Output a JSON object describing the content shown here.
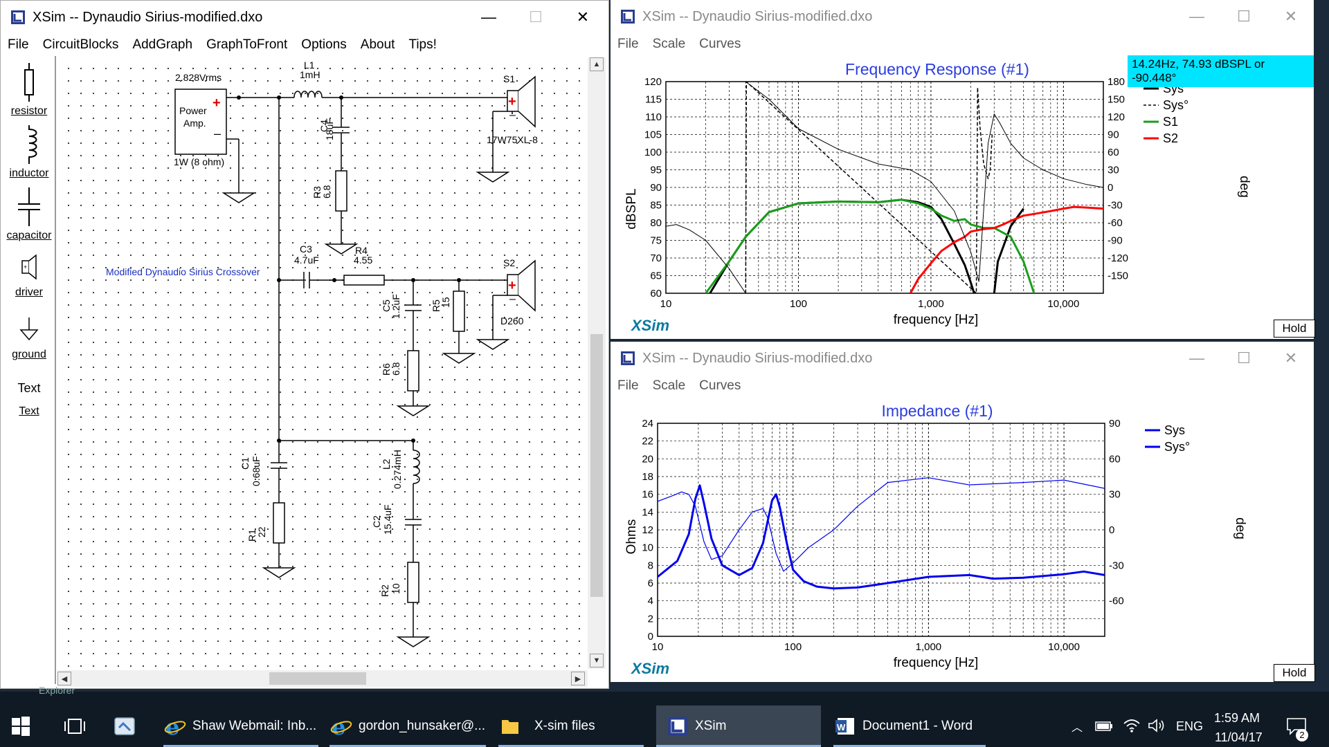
{
  "schematic": {
    "window_title": "XSim -- Dynaudio Sirius-modified.dxo",
    "menu": [
      "File",
      "CircuitBlocks",
      "AddGraph",
      "GraphToFront",
      "Options",
      "About",
      "Tips!"
    ],
    "palette": [
      {
        "icon": "resistor-icon",
        "label": "resistor"
      },
      {
        "icon": "inductor-icon",
        "label": "inductor"
      },
      {
        "icon": "capacitor-icon",
        "label": "capacitor"
      },
      {
        "icon": "driver-icon",
        "label": "driver"
      },
      {
        "icon": "ground-icon",
        "label": "ground"
      },
      {
        "icon": "text-icon",
        "glyph": "Text",
        "label": "Text"
      }
    ],
    "labels": {
      "source_voltage": "2.828Vrms",
      "source_name": "Power\nAmp.",
      "source_power": "1W (8 ohm)",
      "note": "Modified Dynaudio Sirius Crossover",
      "L1": "L1",
      "L1_val": "1mH",
      "C4": "C4",
      "C4_val": "18uF",
      "R3": "R3",
      "R3_val": "6.8",
      "S1": "S1",
      "S1_model": "17W75XL-8",
      "C3": "C3",
      "C3_val": "4.7uF",
      "R4": "R4",
      "R4_val": "4.55",
      "S2": "S2",
      "S2_model": "D260",
      "C5": "C5",
      "C5_val": "1.2uF",
      "R5": "R5",
      "R5_val": "15",
      "R6": "R6",
      "R6_val": "6.8",
      "C1": "C1",
      "C1_val": "0.68uF",
      "R1": "R1",
      "R1_val": "22",
      "L2": "L2",
      "L2_val": "0.274mH",
      "C2": "C2",
      "C2_val": "15.4uF",
      "R2": "R2",
      "R2_val": "10"
    }
  },
  "freq_window": {
    "window_title": "XSim -- Dynaudio Sirius-modified.dxo",
    "menu": [
      "File",
      "Scale",
      "Curves"
    ],
    "title": "Frequency Response (#1)",
    "readout": "14.24Hz, 74.93 dBSPL or -90.448°",
    "xlabel": "frequency [Hz]",
    "ylabel": "dBSPL",
    "y2label": "deg",
    "brand": "XSim",
    "hold_label": "Hold"
  },
  "imp_window": {
    "window_title": "XSim -- Dynaudio Sirius-modified.dxo",
    "menu": [
      "File",
      "Scale",
      "Curves"
    ],
    "title": "Impedance (#1)",
    "xlabel": "frequency [Hz]",
    "ylabel": "Ohms",
    "y2label": "deg",
    "brand": "XSim",
    "hold_label": "Hold"
  },
  "chart_data": [
    {
      "type": "line",
      "title": "Frequency Response (#1)",
      "xlabel": "frequency [Hz]",
      "ylabel": "dBSPL",
      "y2label": "deg",
      "xscale": "log",
      "xlim": [
        10,
        20000
      ],
      "ylim": [
        60,
        120
      ],
      "y2lim": [
        -180,
        180
      ],
      "x_ticks": [
        "10",
        "100",
        "1,000",
        "10,000"
      ],
      "y_ticks": [
        "60",
        "65",
        "70",
        "75",
        "80",
        "85",
        "90",
        "95",
        "100",
        "105",
        "110",
        "115",
        "120"
      ],
      "y2_ticks": [
        "-150",
        "-120",
        "-90",
        "-60",
        "-30",
        "0",
        "30",
        "60",
        "90",
        "120",
        "150",
        "180"
      ],
      "grid": true,
      "legend_position": "right",
      "series": [
        {
          "name": "Sys",
          "axis": "left",
          "color": "#000000",
          "style": "solid",
          "width": 3,
          "x": [
            10,
            15,
            20,
            30,
            40,
            60,
            100,
            200,
            400,
            600,
            800,
            1000,
            1200,
            1500,
            1800,
            2000,
            2200,
            2400,
            2600,
            3000,
            3200,
            4000,
            5000
          ],
          "y": [
            52,
            55,
            58,
            69,
            76,
            83,
            85.5,
            86,
            85.8,
            86.5,
            85.8,
            84.5,
            81,
            74,
            68,
            63,
            58,
            55,
            56,
            60,
            69,
            79,
            84
          ]
        },
        {
          "name": "Sys°",
          "axis": "right",
          "color": "#000000",
          "style": "dashed",
          "width": 1.5,
          "x": [
            40,
            40.5,
            2200,
            2250,
            2350,
            2500,
            2700,
            2800,
            2900
          ],
          "y": [
            -180,
            180,
            -180,
            170,
            100,
            40,
            15,
            30,
            90
          ]
        },
        {
          "name": "S1",
          "axis": "left",
          "color": "#1a9e1a",
          "style": "solid",
          "width": 3,
          "x": [
            20,
            30,
            40,
            60,
            100,
            200,
            400,
            600,
            800,
            1000,
            1200,
            1500,
            1800,
            2000,
            2500,
            3000,
            4000,
            5000,
            6000
          ],
          "y": [
            60,
            69,
            76,
            83,
            85.5,
            86,
            85.8,
            86.5,
            85.5,
            84,
            82,
            80.5,
            81,
            79.5,
            78.5,
            78.5,
            76,
            69,
            60
          ]
        },
        {
          "name": "S2",
          "axis": "left",
          "color": "#ff0000",
          "style": "solid",
          "width": 3,
          "x": [
            700,
            800,
            1000,
            1200,
            1500,
            1800,
            2000,
            2500,
            3000,
            3500,
            4000,
            5000,
            6000,
            8000,
            10000,
            12000,
            15000,
            20000
          ],
          "y": [
            60,
            64,
            68.5,
            72,
            74.5,
            76,
            77.5,
            78.2,
            78.5,
            79.5,
            80.5,
            82,
            82.5,
            83.3,
            84,
            84.5,
            84.3,
            84
          ]
        },
        {
          "name": "",
          "axis": "left",
          "color": "#000000",
          "style": "solid",
          "width": 1,
          "x": [
            10,
            12,
            15,
            20,
            30,
            40
          ],
          "y": [
            79,
            79.5,
            78,
            75,
            67,
            60
          ]
        },
        {
          "name": "",
          "axis": "right",
          "color": "#000000",
          "style": "solid",
          "width": 1,
          "x": [
            40,
            60,
            100,
            200,
            400,
            700,
            1000,
            1500,
            2000,
            2300,
            2700,
            3000,
            3300,
            4000,
            5000,
            7000,
            10000,
            15000,
            20000
          ],
          "y": [
            180,
            150,
            100,
            65,
            40,
            30,
            10,
            -40,
            -110,
            -160,
            75,
            125,
            110,
            75,
            50,
            30,
            15,
            5,
            0
          ]
        }
      ]
    },
    {
      "type": "line",
      "title": "Impedance (#1)",
      "xlabel": "frequency [Hz]",
      "ylabel": "Ohms",
      "y2label": "deg",
      "xscale": "log",
      "xlim": [
        10,
        20000
      ],
      "ylim": [
        0,
        24
      ],
      "y2lim": [
        -90,
        90
      ],
      "x_ticks": [
        "10",
        "100",
        "1,000",
        "10,000"
      ],
      "y_ticks": [
        "0",
        "2",
        "4",
        "6",
        "8",
        "10",
        "12",
        "14",
        "16",
        "18",
        "20",
        "22",
        "24"
      ],
      "y2_ticks": [
        "-60",
        "-30",
        "0",
        "30",
        "60",
        "90"
      ],
      "grid": true,
      "legend_position": "top-right",
      "series": [
        {
          "name": "Sys",
          "axis": "left",
          "color": "#0000ee",
          "style": "solid",
          "width": 3,
          "x": [
            10,
            14,
            17,
            19,
            20.5,
            22,
            25,
            30,
            40,
            50,
            60,
            70,
            75,
            80,
            90,
            100,
            120,
            150,
            200,
            300,
            500,
            1000,
            2000,
            3000,
            5000,
            10000,
            14000,
            20000
          ],
          "y": [
            6.7,
            8.5,
            11.5,
            15.5,
            17.0,
            15,
            11,
            8,
            6.9,
            7.7,
            10.5,
            15.3,
            16.0,
            14.5,
            10.5,
            7.5,
            6.2,
            5.6,
            5.4,
            5.5,
            6.0,
            6.7,
            6.9,
            6.5,
            6.6,
            7.0,
            7.3,
            6.9
          ]
        },
        {
          "name": "Sys°",
          "axis": "right",
          "color": "#0000ee",
          "style": "solid",
          "width": 1.2,
          "x": [
            10,
            13,
            15,
            17,
            19,
            22,
            25,
            30,
            40,
            50,
            60,
            65,
            75,
            85,
            100,
            130,
            200,
            300,
            500,
            1000,
            2000,
            5000,
            10000,
            20000
          ],
          "y": [
            24,
            29,
            32,
            30,
            20,
            -10,
            -25,
            -22,
            0,
            15,
            18,
            10,
            -20,
            -35,
            -28,
            -15,
            0,
            20,
            40,
            44,
            38,
            40,
            42,
            35
          ]
        }
      ]
    }
  ],
  "taskbar": {
    "items": [
      {
        "icon": "task-view-icon",
        "label": ""
      },
      {
        "icon": "app-icon",
        "label": ""
      },
      {
        "icon": "internet-explorer-icon",
        "label": "Shaw Webmail: Inb..."
      },
      {
        "icon": "internet-explorer-icon",
        "label": "gordon_hunsaker@..."
      },
      {
        "icon": "folder-icon",
        "label": "X-sim files"
      },
      {
        "icon": "xsim-icon",
        "label": "XSim"
      },
      {
        "icon": "word-icon",
        "label": "Document1 - Word"
      }
    ],
    "language": "ENG",
    "time": "1:59 AM",
    "date": "11/04/17",
    "notification_count": "2",
    "partial_label": "Explorer"
  }
}
